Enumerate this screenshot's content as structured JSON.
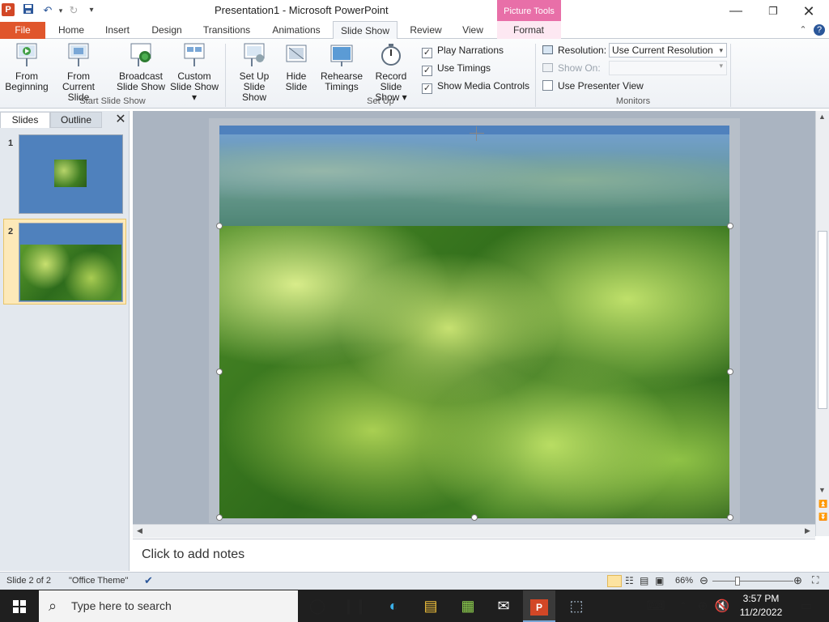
{
  "window": {
    "title": "Presentation1  -  Microsoft PowerPoint",
    "context_tab_group": "Picture Tools",
    "app_icon_letter": "P"
  },
  "tabs": [
    "File",
    "Home",
    "Insert",
    "Design",
    "Transitions",
    "Animations",
    "Slide Show",
    "Review",
    "View",
    "Format"
  ],
  "ribbon": {
    "start_group": "Start Slide Show",
    "setup_group": "Set Up",
    "monitors_group": "Monitors",
    "from_beginning": [
      "From",
      "Beginning"
    ],
    "from_current": [
      "From",
      "Current Slide"
    ],
    "broadcast": [
      "Broadcast",
      "Slide Show"
    ],
    "custom": [
      "Custom",
      "Slide Show ▾"
    ],
    "setup": [
      "Set Up",
      "Slide Show"
    ],
    "hide": [
      "Hide",
      "Slide"
    ],
    "rehearse": [
      "Rehearse",
      "Timings"
    ],
    "record": [
      "Record Slide",
      "Show ▾"
    ],
    "play_narrations": "Play Narrations",
    "use_timings": "Use Timings",
    "show_media": "Show Media Controls",
    "resolution_label": "Resolution:",
    "resolution_value": "Use Current Resolution",
    "show_on_label": "Show On:",
    "presenter_view": "Use Presenter View"
  },
  "panel": {
    "slides_tab": "Slides",
    "outline_tab": "Outline",
    "thumb_numbers": [
      "1",
      "2"
    ]
  },
  "notes_placeholder": "Click to add notes",
  "status": {
    "slide": "Slide 2 of 2",
    "theme": "\"Office Theme\"",
    "zoom": "66%"
  },
  "taskbar": {
    "search_placeholder": "Type here to search",
    "time": "3:57 PM",
    "date": "11/2/2022"
  },
  "colors": {
    "file_tab": "#e0562c",
    "picture_tools": "#e86fa8",
    "slide_bg": "#4f81bd"
  }
}
